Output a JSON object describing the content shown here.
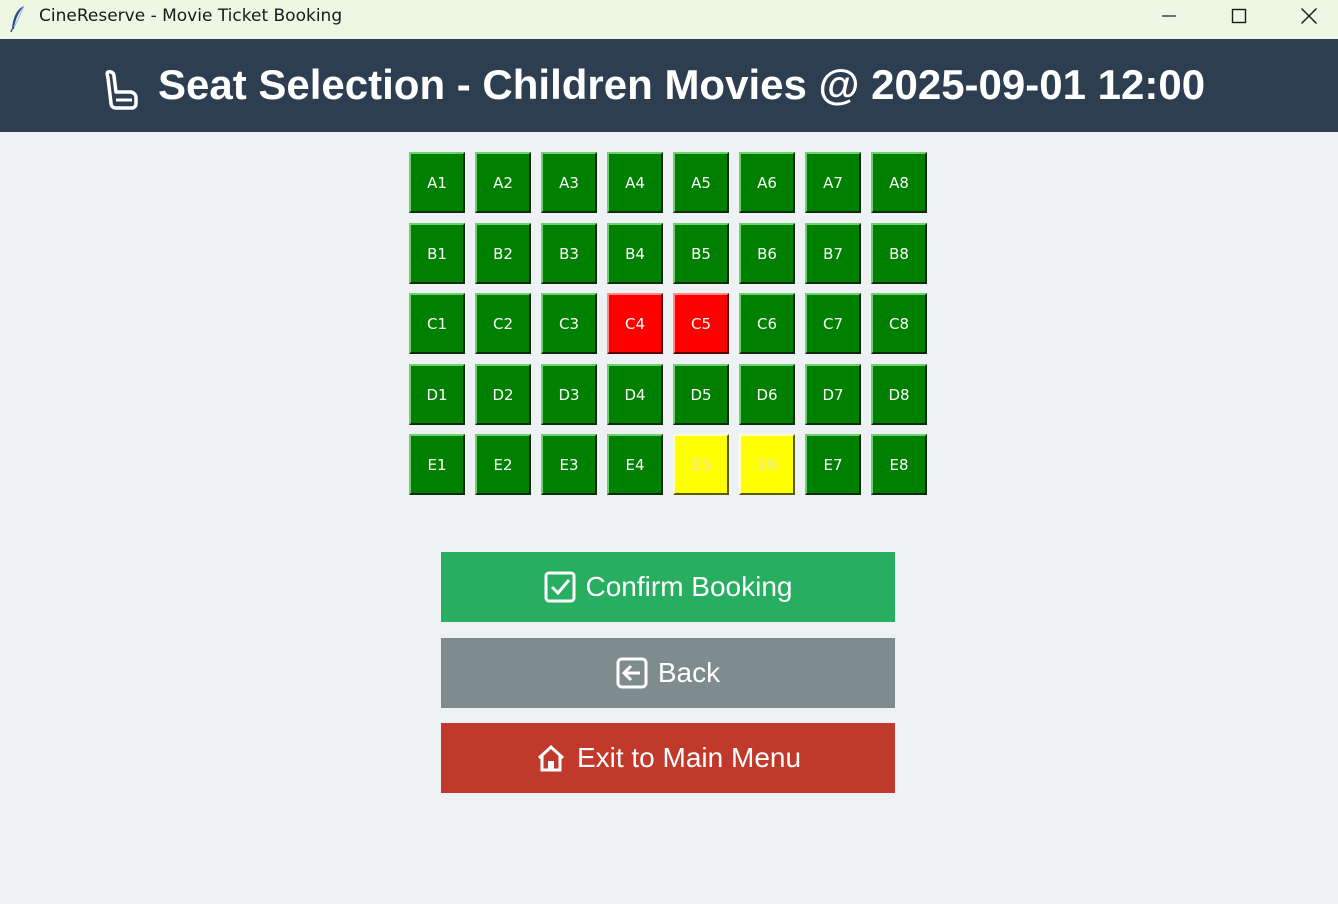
{
  "window": {
    "title": "CineReserve - Movie Ticket Booking"
  },
  "header": {
    "title": "Seat Selection - Children Movies @ 2025-09-01 12:00",
    "icon": "seat-icon"
  },
  "legend_colors": {
    "available": "#008000",
    "booked": "#ff0000",
    "selected": "#ffff00"
  },
  "seats": [
    [
      {
        "label": "A1",
        "status": "available"
      },
      {
        "label": "A2",
        "status": "available"
      },
      {
        "label": "A3",
        "status": "available"
      },
      {
        "label": "A4",
        "status": "available"
      },
      {
        "label": "A5",
        "status": "available"
      },
      {
        "label": "A6",
        "status": "available"
      },
      {
        "label": "A7",
        "status": "available"
      },
      {
        "label": "A8",
        "status": "available"
      }
    ],
    [
      {
        "label": "B1",
        "status": "available"
      },
      {
        "label": "B2",
        "status": "available"
      },
      {
        "label": "B3",
        "status": "available"
      },
      {
        "label": "B4",
        "status": "available"
      },
      {
        "label": "B5",
        "status": "available"
      },
      {
        "label": "B6",
        "status": "available"
      },
      {
        "label": "B7",
        "status": "available"
      },
      {
        "label": "B8",
        "status": "available"
      }
    ],
    [
      {
        "label": "C1",
        "status": "available"
      },
      {
        "label": "C2",
        "status": "available"
      },
      {
        "label": "C3",
        "status": "available"
      },
      {
        "label": "C4",
        "status": "booked"
      },
      {
        "label": "C5",
        "status": "booked"
      },
      {
        "label": "C6",
        "status": "available"
      },
      {
        "label": "C7",
        "status": "available"
      },
      {
        "label": "C8",
        "status": "available"
      }
    ],
    [
      {
        "label": "D1",
        "status": "available"
      },
      {
        "label": "D2",
        "status": "available"
      },
      {
        "label": "D3",
        "status": "available"
      },
      {
        "label": "D4",
        "status": "available"
      },
      {
        "label": "D5",
        "status": "available"
      },
      {
        "label": "D6",
        "status": "available"
      },
      {
        "label": "D7",
        "status": "available"
      },
      {
        "label": "D8",
        "status": "available"
      }
    ],
    [
      {
        "label": "E1",
        "status": "available"
      },
      {
        "label": "E2",
        "status": "available"
      },
      {
        "label": "E3",
        "status": "available"
      },
      {
        "label": "E4",
        "status": "available"
      },
      {
        "label": "E5",
        "status": "selected"
      },
      {
        "label": "E6",
        "status": "selected"
      },
      {
        "label": "E7",
        "status": "available"
      },
      {
        "label": "E8",
        "status": "available"
      }
    ]
  ],
  "actions": {
    "confirm_label": "Confirm Booking",
    "confirm_icon": "check-box-icon",
    "back_label": "Back",
    "back_icon": "arrow-left-box-icon",
    "exit_label": "Exit to Main Menu",
    "exit_icon": "house-icon",
    "confirm_color": "#27ae60",
    "back_color": "#7f8c8d",
    "exit_color": "#c0392b"
  }
}
